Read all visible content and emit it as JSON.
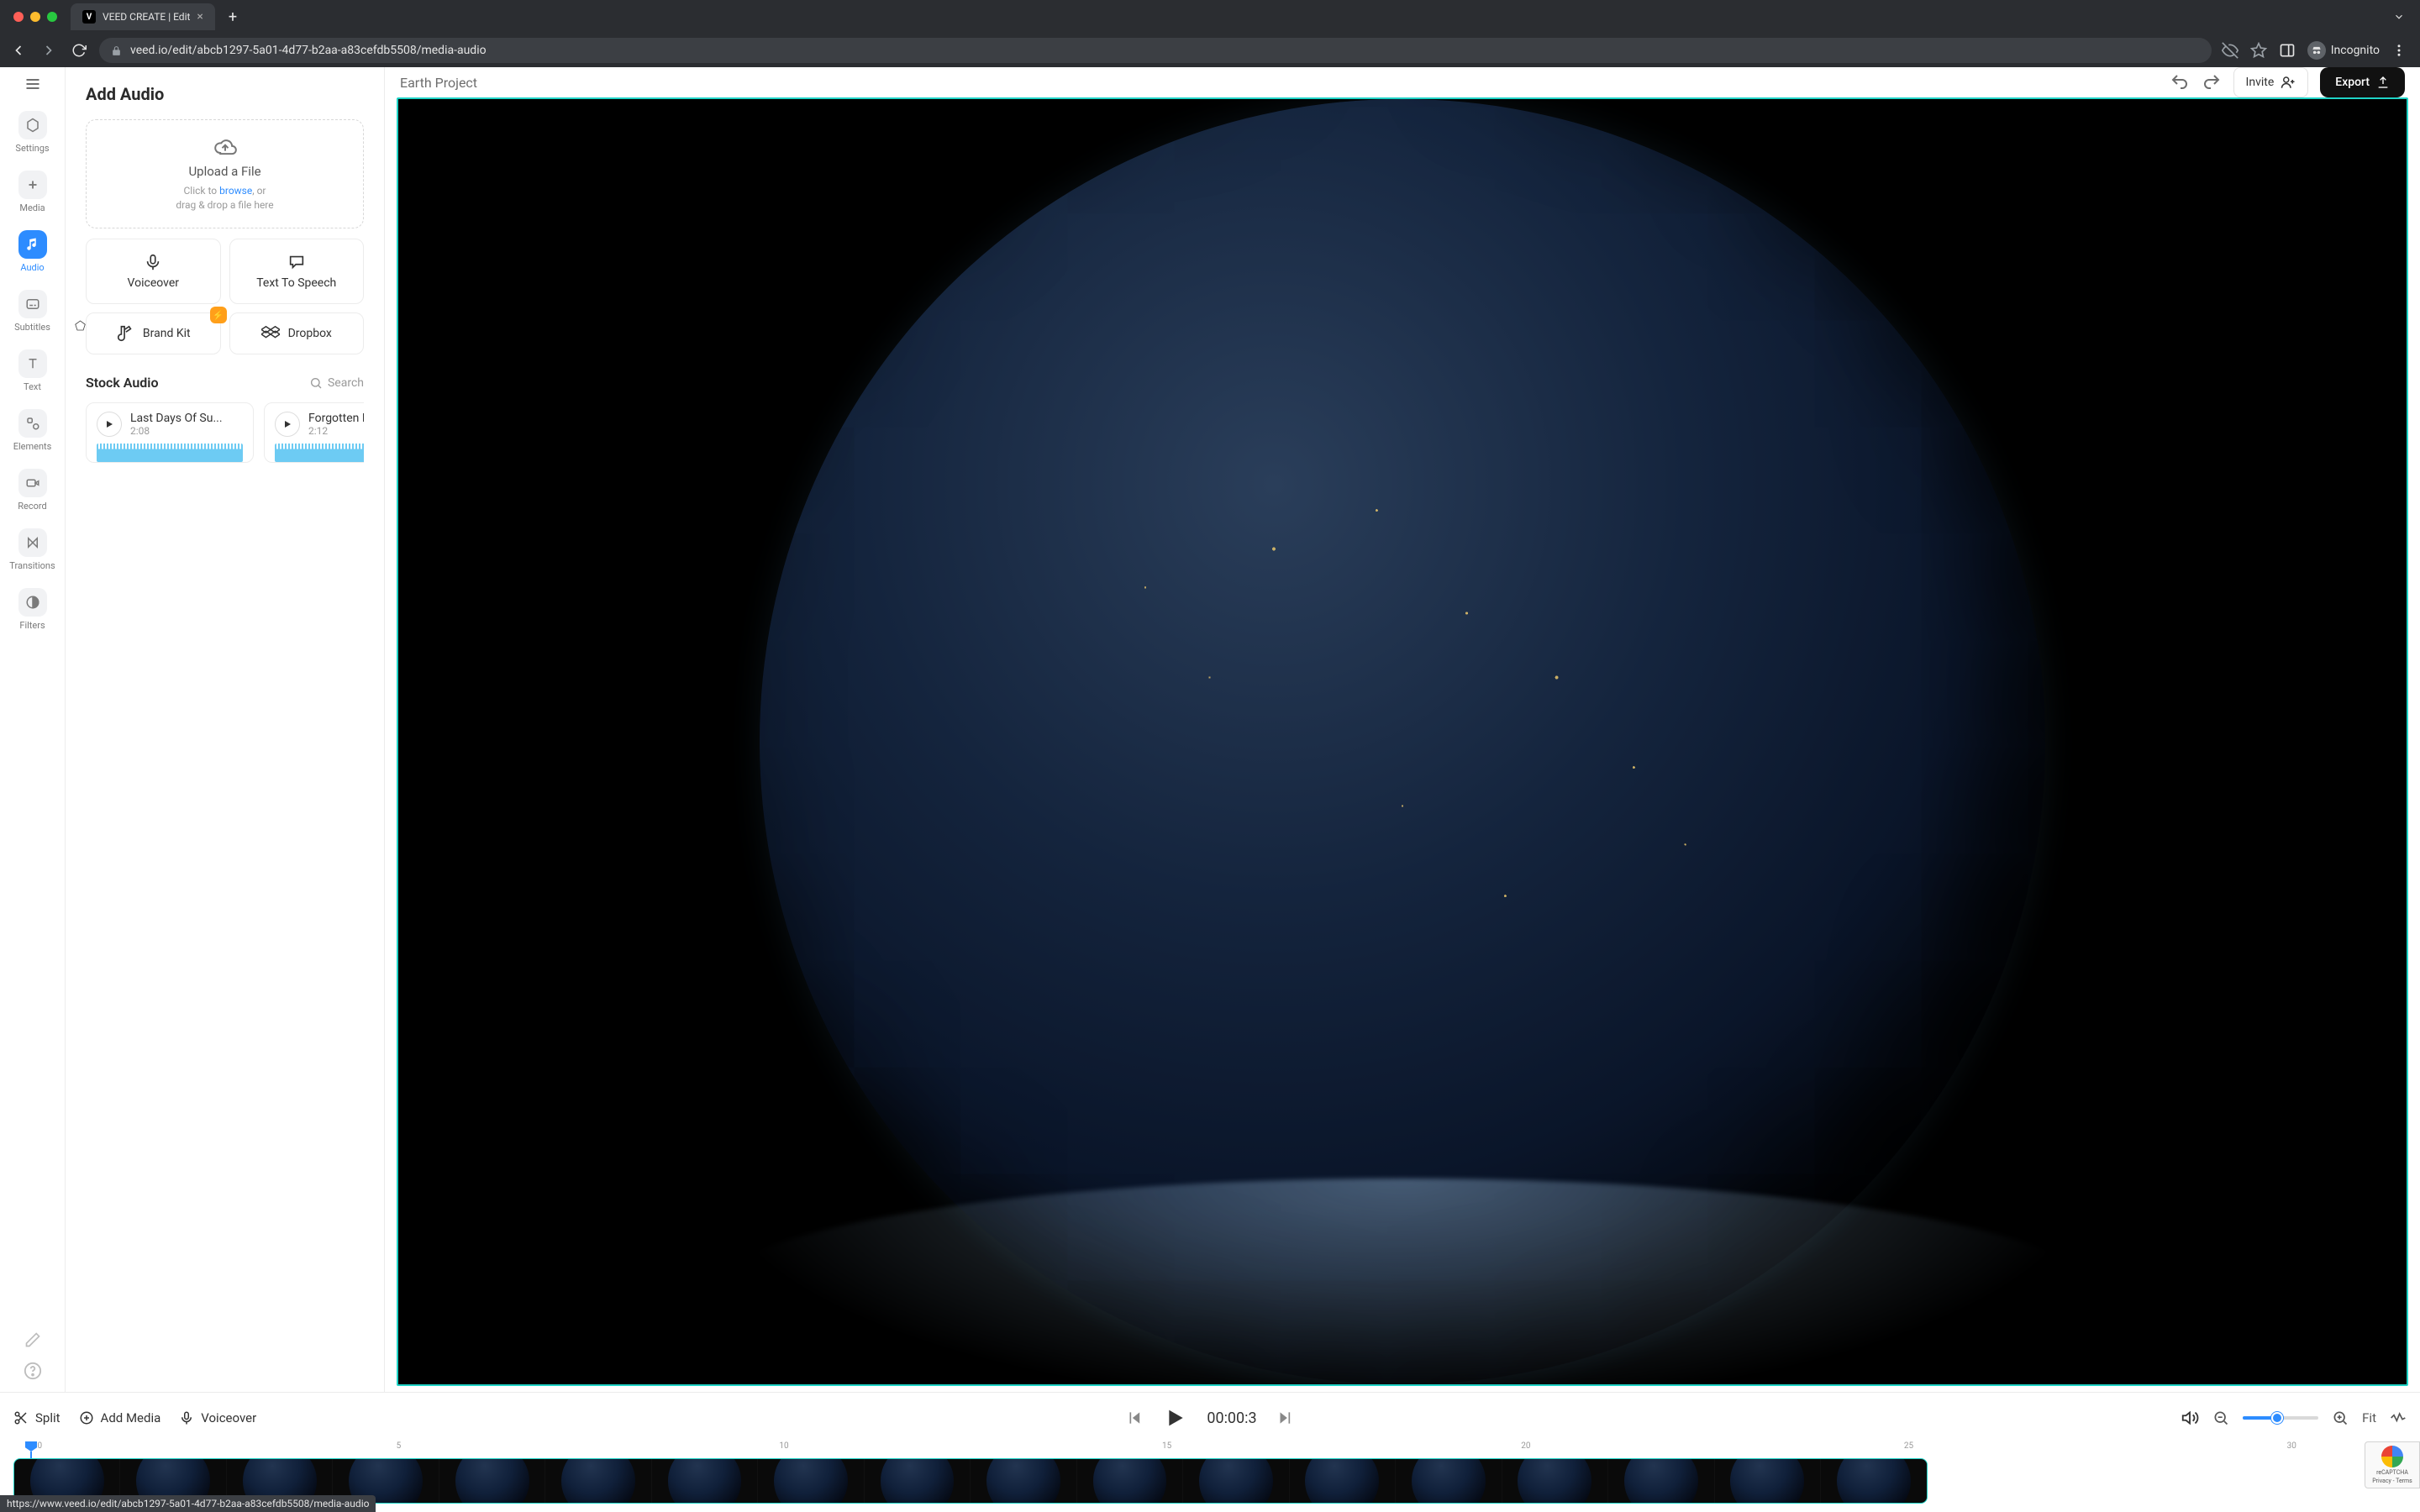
{
  "browser": {
    "tab_title": "VEED CREATE | Edit",
    "url": "veed.io/edit/abcb1297-5a01-4d77-b2aa-a83cefdb5508/media-audio",
    "incognito_label": "Incognito",
    "status_url": "https://www.veed.io/edit/abcb1297-5a01-4d77-b2aa-a83cefdb5508/media-audio"
  },
  "rail": {
    "items": [
      {
        "key": "settings",
        "label": "Settings"
      },
      {
        "key": "media",
        "label": "Media"
      },
      {
        "key": "audio",
        "label": "Audio"
      },
      {
        "key": "subtitles",
        "label": "Subtitles"
      },
      {
        "key": "text",
        "label": "Text"
      },
      {
        "key": "elements",
        "label": "Elements"
      },
      {
        "key": "record",
        "label": "Record"
      },
      {
        "key": "transitions",
        "label": "Transitions"
      },
      {
        "key": "filters",
        "label": "Filters"
      }
    ]
  },
  "panel": {
    "title": "Add Audio",
    "upload": {
      "title": "Upload a File",
      "hint_prefix": "Click to ",
      "hint_link": "browse",
      "hint_suffix": ", or",
      "hint_line2": "drag & drop a file here"
    },
    "options": {
      "voiceover": "Voiceover",
      "tts": "Text To Speech",
      "brandkit": "Brand Kit",
      "dropbox": "Dropbox"
    },
    "stock": {
      "title": "Stock Audio",
      "search_placeholder": "Search",
      "tracks": [
        {
          "title": "Last Days Of Su...",
          "duration": "2:08"
        },
        {
          "title": "Forgotten Her",
          "duration": "2:12"
        }
      ]
    }
  },
  "topbar": {
    "project_name": "Earth Project",
    "invite": "Invite",
    "export": "Export"
  },
  "timeline": {
    "split": "Split",
    "add_media": "Add Media",
    "voiceover": "Voiceover",
    "time": "00:00:3",
    "fit": "Fit",
    "ticks": [
      "0",
      "5",
      "10",
      "15",
      "20",
      "25",
      "30"
    ]
  },
  "recaptcha": {
    "line1": "reCAPTCHA",
    "line2": "Privacy - Terms"
  }
}
